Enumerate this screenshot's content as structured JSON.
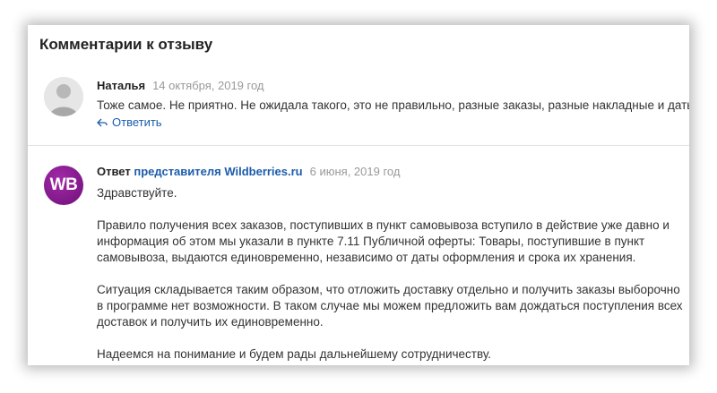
{
  "header": {
    "title": "Комментарии к отзыву"
  },
  "comment": {
    "author": "Наталья",
    "date": "14 октября, 2019 год",
    "text": "Тоже самое. Не приятно. Не ожидала такого, это не правильно, разные заказы, разные накладные и даты.",
    "reply_label": "Ответить"
  },
  "answer": {
    "label_prefix": "Ответ",
    "label_rep": "представителя Wildberries.ru",
    "date": "6 июня, 2019 год",
    "avatar_text": "WB",
    "greeting": "Здравствуйте.",
    "paragraph1": "Правило получения всех заказов, поступивших в пункт самовывоза вступило в действие уже давно и информация об этом мы указали в пункте 7.11 Публичной оферты: Товары, поступившие в пункт самовывоза, выдаются единовременно, независимо от даты оформления и срока их хранения.",
    "paragraph2": "Ситуация складывается таким образом, что отложить доставку отдельно и получить заказы выборочно в программе нет возможности. В таком случае мы можем предложить вам дождаться поступления всех доставок и получить их единовременно.",
    "paragraph3": "Надеемся на понимание и будем рады дальнейшему сотрудничеству."
  },
  "colors": {
    "accent": "#1c5cab",
    "wb_brand": "#8a1b91",
    "muted": "#999999"
  }
}
